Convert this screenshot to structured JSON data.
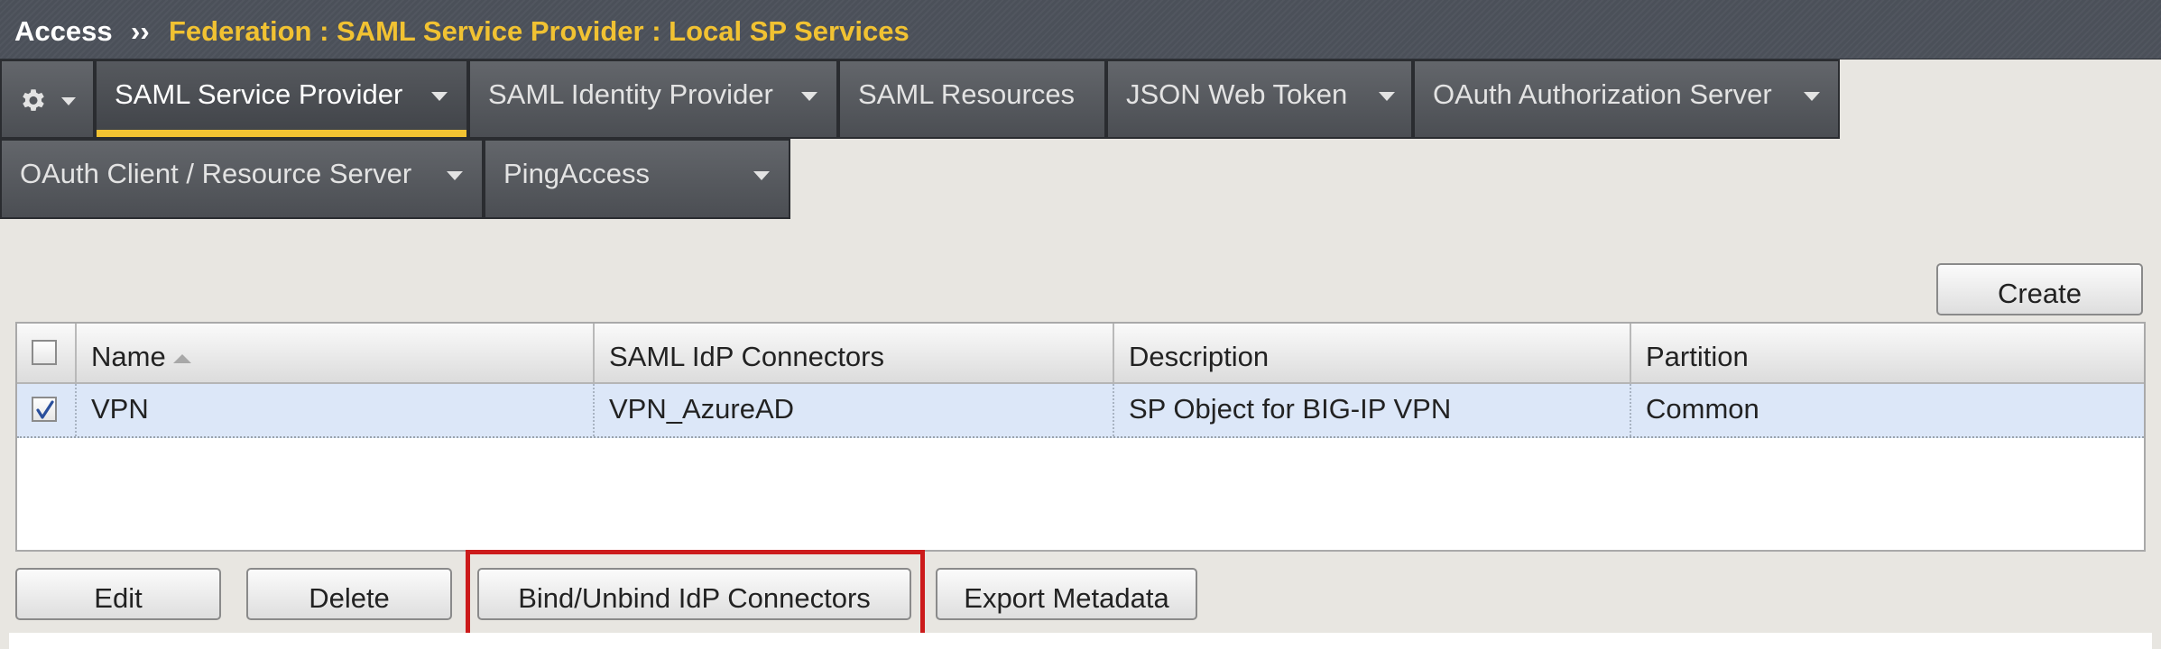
{
  "header": {
    "root": "Access",
    "separator": "››",
    "path": "Federation : SAML Service Provider : Local SP Services"
  },
  "tabs": {
    "row1": [
      {
        "label": "SAML Service Provider",
        "active": true,
        "has_menu": true
      },
      {
        "label": "SAML Identity Provider",
        "active": false,
        "has_menu": true
      },
      {
        "label": "SAML Resources",
        "active": false,
        "has_menu": false
      },
      {
        "label": "JSON Web Token",
        "active": false,
        "has_menu": true
      },
      {
        "label": "OAuth Authorization Server",
        "active": false,
        "has_menu": true
      }
    ],
    "row2": [
      {
        "label": "OAuth Client / Resource Server",
        "active": false,
        "has_menu": true
      },
      {
        "label": "PingAccess",
        "active": false,
        "has_menu": true
      }
    ],
    "settings_icon": "gear-icon"
  },
  "toolbar": {
    "create_label": "Create"
  },
  "table": {
    "columns": [
      "Name",
      "SAML IdP Connectors",
      "Description",
      "Partition"
    ],
    "sort_column": "Name",
    "sort_direction": "ascending",
    "select_all_checked": false,
    "rows": [
      {
        "checked": true,
        "name": "VPN",
        "connectors": "VPN_AzureAD",
        "description": "SP Object for BIG-IP VPN",
        "partition": "Common"
      }
    ]
  },
  "actions": {
    "edit": "Edit",
    "delete": "Delete",
    "bind": "Bind/Unbind IdP Connectors",
    "export": "Export Metadata"
  },
  "colors": {
    "accent": "#f1c232",
    "header_bg": "#4b5059",
    "highlight": "#cc1b1b",
    "selected_row": "#dce7f8"
  }
}
